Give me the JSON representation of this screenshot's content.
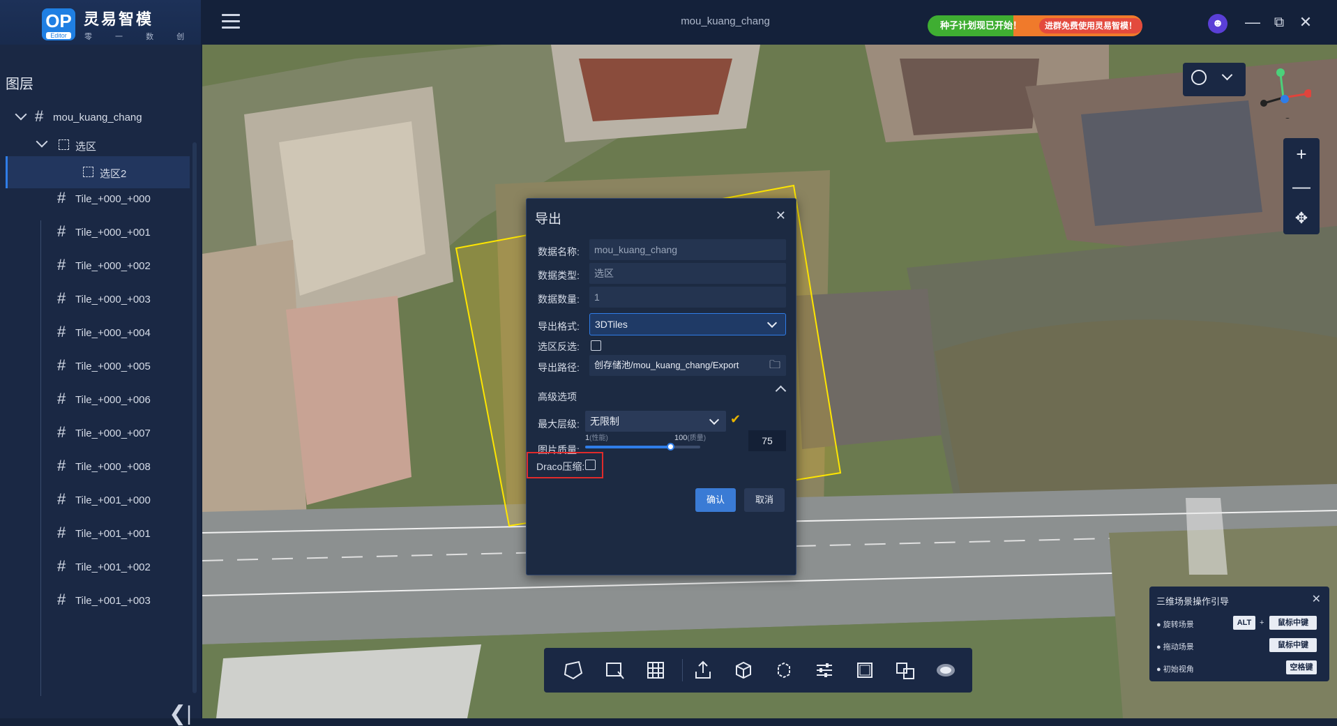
{
  "app": {
    "name": "灵易智模",
    "logo": "OP",
    "logo_sub": "Editor",
    "tagline": "零 一 数 创",
    "document_title": "mou_kuang_chang"
  },
  "banner": {
    "text": "种子计划现已开始！",
    "cta": "进群免费使用灵易智模！"
  },
  "sidebar": {
    "title": "图层",
    "tree": [
      {
        "label": "mou_kuang_chang",
        "icon": "hash-icon",
        "level": 0,
        "expanded": true
      },
      {
        "label": "选区",
        "icon": "selection-icon",
        "level": 1,
        "expanded": true
      },
      {
        "label": "选区2",
        "icon": "selection-icon",
        "level": 2,
        "selected": true
      },
      {
        "label": "Tile_+000_+000",
        "icon": "hash-icon",
        "level": 1
      },
      {
        "label": "Tile_+000_+001",
        "icon": "hash-icon",
        "level": 1
      },
      {
        "label": "Tile_+000_+002",
        "icon": "hash-icon",
        "level": 1
      },
      {
        "label": "Tile_+000_+003",
        "icon": "hash-icon",
        "level": 1
      },
      {
        "label": "Tile_+000_+004",
        "icon": "hash-icon",
        "level": 1
      },
      {
        "label": "Tile_+000_+005",
        "icon": "hash-icon",
        "level": 1
      },
      {
        "label": "Tile_+000_+006",
        "icon": "hash-icon",
        "level": 1
      },
      {
        "label": "Tile_+000_+007",
        "icon": "hash-icon",
        "level": 1
      },
      {
        "label": "Tile_+000_+008",
        "icon": "hash-icon",
        "level": 1
      },
      {
        "label": "Tile_+001_+000",
        "icon": "hash-icon",
        "level": 1
      },
      {
        "label": "Tile_+001_+001",
        "icon": "hash-icon",
        "level": 1
      },
      {
        "label": "Tile_+001_+002",
        "icon": "hash-icon",
        "level": 1
      },
      {
        "label": "Tile_+001_+003",
        "icon": "hash-icon",
        "level": 1
      }
    ]
  },
  "dialog": {
    "title": "导出",
    "fields": {
      "name_label": "数据名称:",
      "name_value": "mou_kuang_chang",
      "type_label": "数据类型:",
      "type_value": "选区",
      "count_label": "数据数量:",
      "count_value": "1",
      "format_label": "导出格式:",
      "format_value": "3DTiles",
      "invert_label": "选区反选:",
      "invert_checked": false,
      "path_label": "导出路径:",
      "path_value": "创存储池/mou_kuang_chang/Export"
    },
    "advanced": {
      "title": "高级选项",
      "max_level_label": "最大层级:",
      "max_level_value": "无限制",
      "quality_label": "图片质量:",
      "quality_min": "1",
      "quality_min_note": "(性能)",
      "quality_max": "100",
      "quality_max_note": "(质量)",
      "quality_value": "75",
      "draco_label": "Draco压缩:",
      "draco_checked": false
    },
    "ok_label": "确认",
    "cancel_label": "取消"
  },
  "guide": {
    "title": "三维场景操作引导",
    "rows": [
      {
        "label": "旋转场景",
        "keys": [
          "ALT",
          "鼠标中键"
        ],
        "plus": "+"
      },
      {
        "label": "拖动场景",
        "keys": [
          "鼠标中键"
        ]
      },
      {
        "label": "初始视角",
        "keys": [
          "空格键"
        ]
      }
    ]
  },
  "colors": {
    "accent": "#2f7de8",
    "panel": "#1a2844",
    "highlight": "#e02b2b",
    "selection_outline": "#ffe600"
  }
}
